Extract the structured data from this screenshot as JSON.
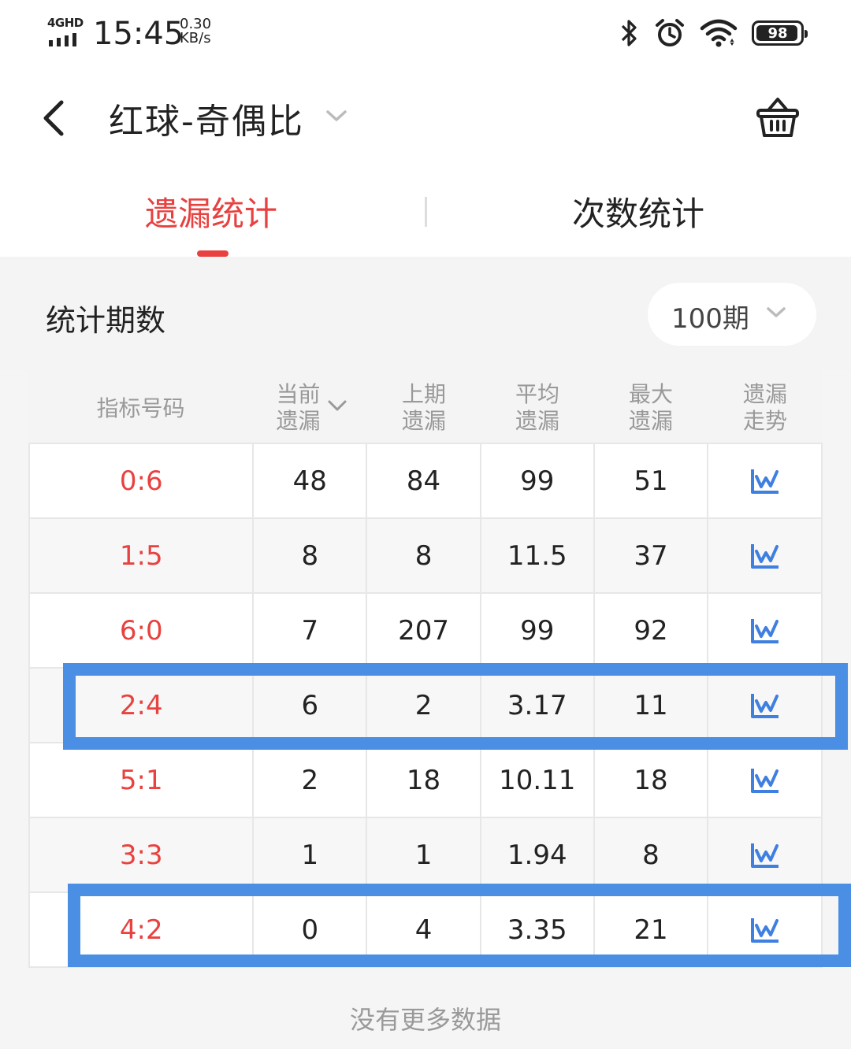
{
  "status_bar": {
    "network": "4GHD",
    "time": "15:45",
    "speed_value": "0.30",
    "speed_unit": "KB/s",
    "battery": "98",
    "icons": [
      "bluetooth-icon",
      "alarm-icon",
      "wifi-icon",
      "battery-icon"
    ]
  },
  "header": {
    "title": "红球-奇偶比",
    "back_icon": "chevron-left-icon",
    "dropdown_icon": "chevron-down-icon",
    "cart_icon": "basket-icon"
  },
  "tabs": [
    {
      "label": "遗漏统计",
      "active": true
    },
    {
      "label": "次数统计",
      "active": false
    }
  ],
  "period": {
    "label": "统计期数",
    "selected": "100期"
  },
  "table": {
    "headers": [
      {
        "l1": "指标号码",
        "l2": ""
      },
      {
        "l1": "当前",
        "l2": "遗漏"
      },
      {
        "l1": "上期",
        "l2": "遗漏"
      },
      {
        "l1": "平均",
        "l2": "遗漏"
      },
      {
        "l1": "最大",
        "l2": "遗漏"
      },
      {
        "l1": "遗漏",
        "l2": "走势"
      }
    ],
    "rows": [
      {
        "index": "0:6",
        "current": "48",
        "previous": "84",
        "average": "99",
        "max": "51"
      },
      {
        "index": "1:5",
        "current": "8",
        "previous": "8",
        "average": "11.5",
        "max": "37"
      },
      {
        "index": "6:0",
        "current": "7",
        "previous": "207",
        "average": "99",
        "max": "92"
      },
      {
        "index": "2:4",
        "current": "6",
        "previous": "2",
        "average": "3.17",
        "max": "11"
      },
      {
        "index": "5:1",
        "current": "2",
        "previous": "18",
        "average": "10.11",
        "max": "18"
      },
      {
        "index": "3:3",
        "current": "1",
        "previous": "1",
        "average": "1.94",
        "max": "8"
      },
      {
        "index": "4:2",
        "current": "0",
        "previous": "4",
        "average": "3.35",
        "max": "21"
      }
    ],
    "trend_icon": "trend-chart-icon"
  },
  "footer": {
    "no_more": "没有更多数据"
  },
  "colors": {
    "accent_red": "#e8413f",
    "trend_blue": "#3f7fe0",
    "highlight_blue": "#4b8fe5"
  }
}
